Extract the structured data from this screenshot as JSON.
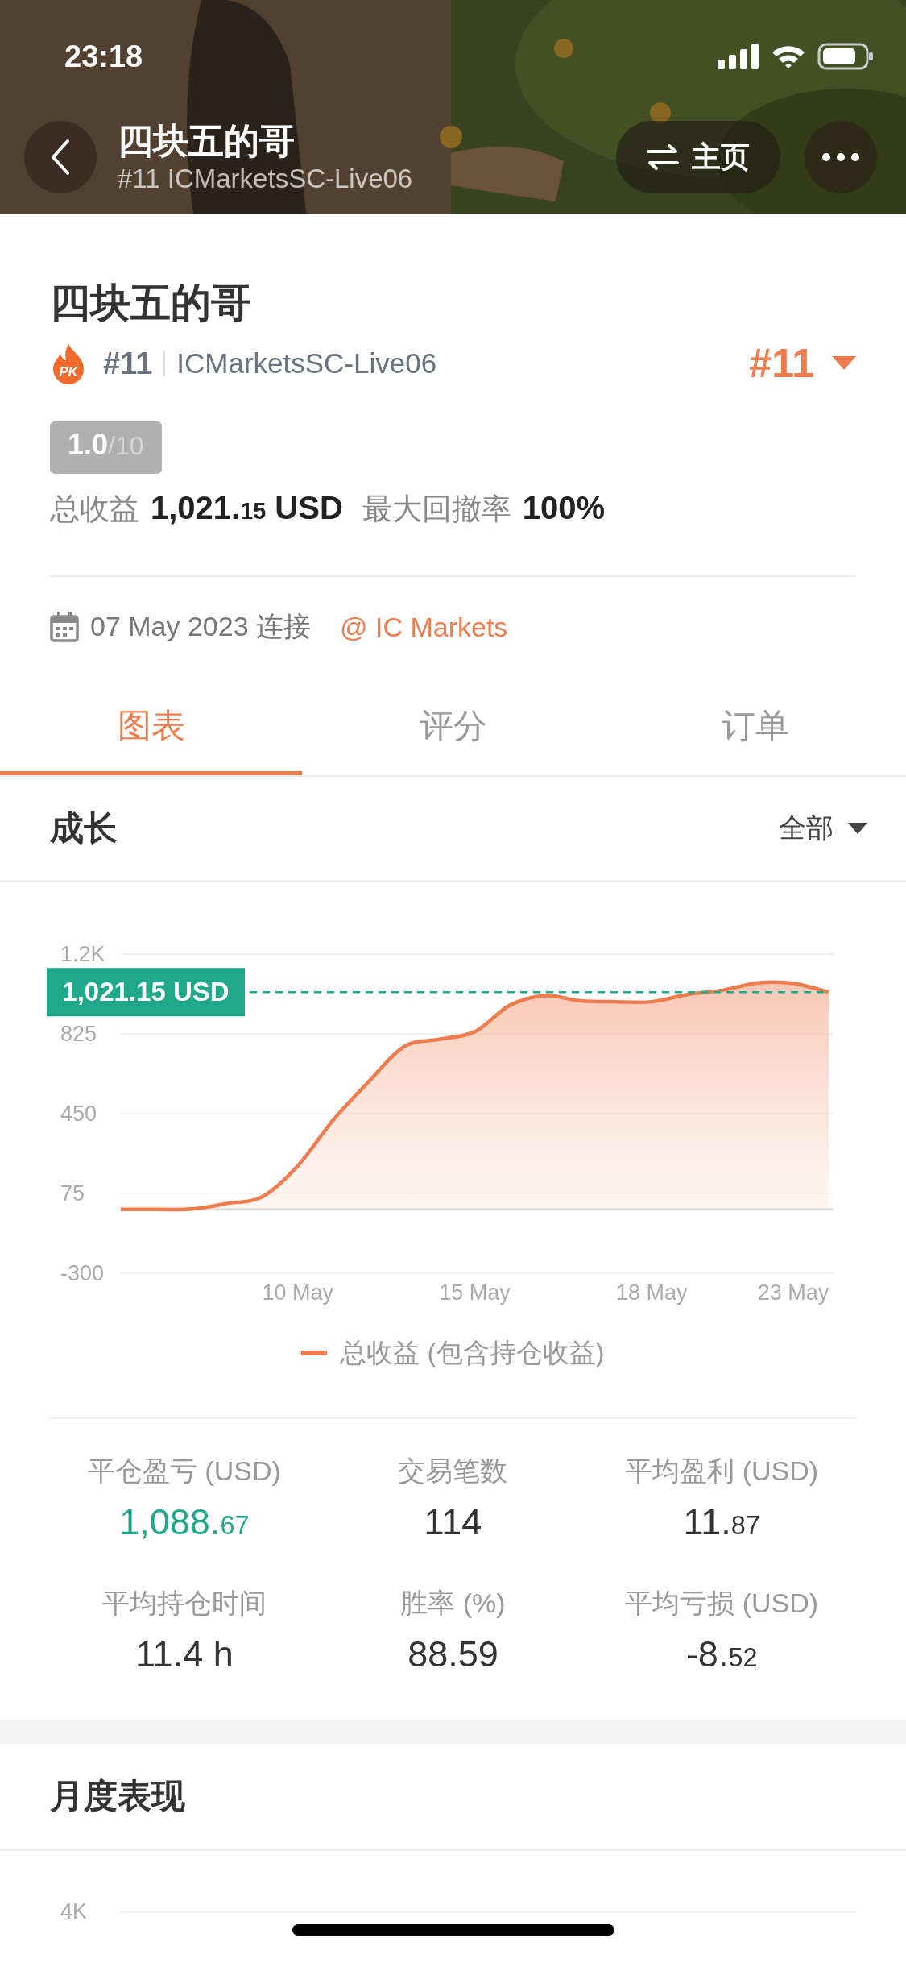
{
  "status_bar": {
    "time": "23:18"
  },
  "header": {
    "title": "四块五的哥",
    "subtitle": "#11 ICMarketsSC-Live06",
    "home_button": "主页"
  },
  "profile": {
    "name": "四块五的哥",
    "pk_badge": "PK",
    "rank": "#11",
    "server": "ICMarketsSC-Live06",
    "rank_dropdown": "#11",
    "score": "1.0",
    "score_max": "/10",
    "total_label": "总收益",
    "total_value": "1,021.",
    "total_decimals": "15",
    "total_unit": "USD",
    "drawdown_label": "最大回撤率",
    "drawdown_value": "100%",
    "connected_date": "07 May 2023 连接",
    "broker": "@ IC Markets"
  },
  "tabs": [
    {
      "label": "图表",
      "selected": true
    },
    {
      "label": "评分",
      "selected": false
    },
    {
      "label": "订单",
      "selected": false
    }
  ],
  "growth": {
    "title": "成长",
    "filter": "全部",
    "chart_data": {
      "type": "area",
      "grid": true,
      "ref_lines": [
        {
          "axis": "y",
          "value": 1021,
          "label": "1,021.15 USD",
          "color": "#1fa88a"
        }
      ],
      "categories": [
        null,
        null,
        null,
        null,
        null,
        "10 May",
        null,
        null,
        null,
        null,
        "15 May",
        null,
        null,
        null,
        null,
        "18 May",
        null,
        null,
        null,
        "23 May",
        null
      ],
      "ylim": [
        -300,
        1200
      ],
      "series": [
        {
          "name": "总收益 (包含持仓收益)",
          "color": "#f07b4c",
          "values": [
            0,
            0,
            2,
            28,
            60,
            205,
            420,
            600,
            765,
            800,
            835,
            960,
            1005,
            980,
            976,
            976,
            1010,
            1030,
            1065,
            1063,
            1021
          ]
        }
      ],
      "yticks": [
        -300,
        75,
        450,
        825,
        {
          "value": 1200,
          "label": "1.2K"
        }
      ]
    }
  },
  "stats": [
    {
      "label": "平仓盈亏 (USD)",
      "value": "1,088.",
      "decimals": "67",
      "positive": true
    },
    {
      "label": "交易笔数",
      "value": "114",
      "positive": false
    },
    {
      "label": "平均盈利 (USD)",
      "value": "11.",
      "decimals": "87",
      "positive": false
    },
    {
      "label": "平均持仓时间",
      "value": "11.4 h",
      "positive": false
    },
    {
      "label": "胜率 (%)",
      "value": "88.59",
      "positive": false
    },
    {
      "label": "平均亏损 (USD)",
      "value": "-8.",
      "decimals": "52",
      "positive": false
    }
  ],
  "monthly": {
    "title": "月度表现",
    "axis_label": "4K"
  }
}
